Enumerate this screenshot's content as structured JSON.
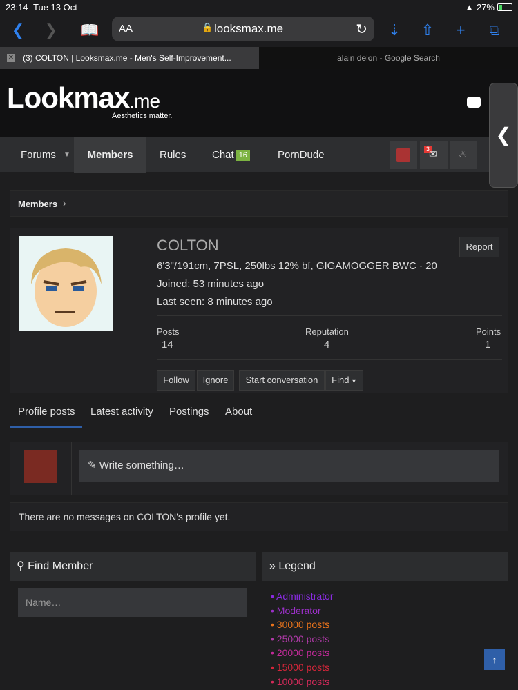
{
  "statusbar": {
    "time": "23:14",
    "date": "Tue 13 Oct",
    "battery": "27%",
    "battery_level": 0.27
  },
  "browser": {
    "aa_label": "AA",
    "url": "looksmax.me",
    "tabs": [
      {
        "title": "(3) COLTON | Looksmax.me - Men's Self-Improvement..."
      },
      {
        "title": "alain delon - Google Search"
      }
    ]
  },
  "site": {
    "logo": "Lookmax",
    "logo_suffix": ".me",
    "tagline": "Aesthetics matter."
  },
  "nav": {
    "items": [
      "Forums",
      "Members",
      "Rules",
      "Chat",
      "PornDude"
    ],
    "chat_count": "16",
    "message_count": "3"
  },
  "breadcrumb": {
    "label": "Members"
  },
  "profile": {
    "username": "COLTON",
    "title": "6'3\"/191cm, 7PSL, 250lbs 12% bf, GIGAMOGGER BWC · 20",
    "joined": "Joined: 53 minutes ago",
    "last_seen": "Last seen: 8 minutes ago",
    "report_label": "Report",
    "stats": [
      {
        "label": "Posts",
        "value": "14"
      },
      {
        "label": "Reputation",
        "value": "4"
      },
      {
        "label": "Points",
        "value": "1"
      }
    ],
    "buttons": [
      "Follow",
      "Ignore",
      "Start conversation",
      "Find"
    ]
  },
  "profile_tabs": [
    "Profile posts",
    "Latest activity",
    "Postings",
    "About"
  ],
  "write_placeholder": "Write something…",
  "no_messages": "There are no messages on COLTON's profile yet.",
  "find_member": {
    "title": "Find Member",
    "placeholder": "Name…"
  },
  "legend": {
    "title": "Legend",
    "items": [
      {
        "label": "Administrator",
        "color": "#8a2be2"
      },
      {
        "label": "Moderator",
        "color": "#9b30c8"
      },
      {
        "label": "30000 posts",
        "color": "#e8731c"
      },
      {
        "label": "25000 posts",
        "color": "#b03aa8"
      },
      {
        "label": "20000 posts",
        "color": "#c42a9a"
      },
      {
        "label": "15000 posts",
        "color": "#d4263a"
      },
      {
        "label": "10000 posts",
        "color": "#d42a5a"
      }
    ]
  }
}
